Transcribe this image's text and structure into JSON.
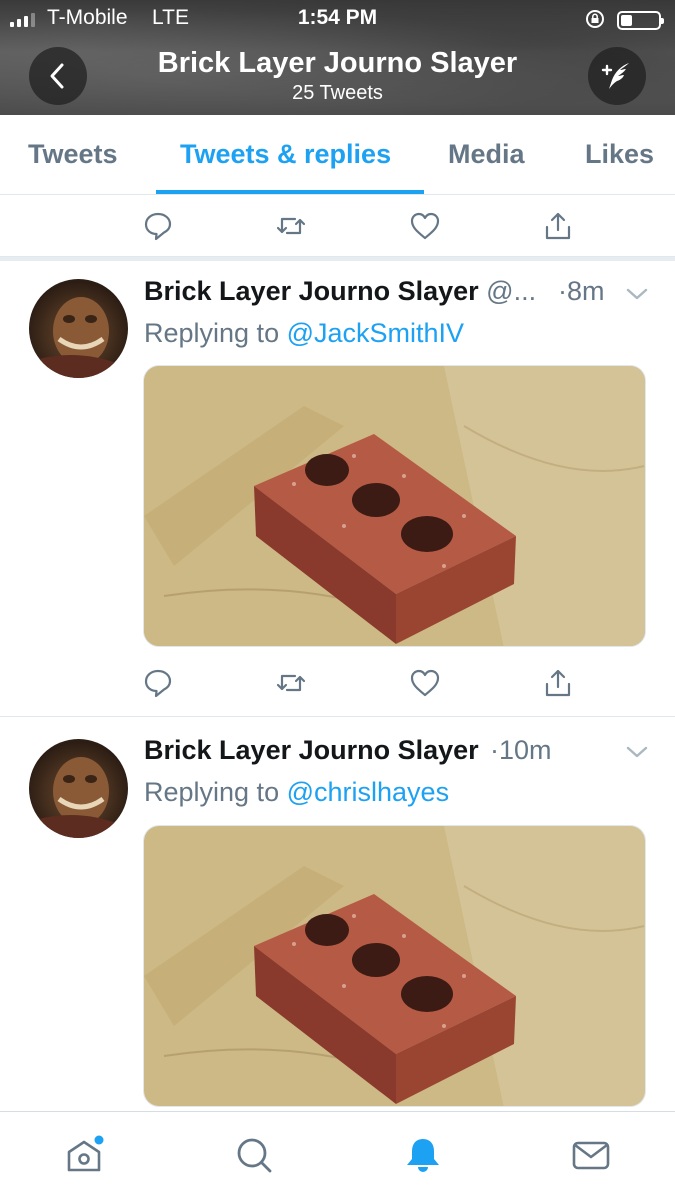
{
  "status_bar": {
    "carrier": "T-Mobile",
    "network": "LTE",
    "time": "1:54 PM",
    "signal_bars": 3,
    "battery_level": 0.3
  },
  "header": {
    "title": "Brick Layer Journo Slayer",
    "subtitle": "25 Tweets",
    "back_icon": "chevron-left-icon",
    "compose_icon": "compose-tweet-icon"
  },
  "tabs": [
    {
      "label": "Tweets",
      "active": false
    },
    {
      "label": "Tweets & replies",
      "active": true
    },
    {
      "label": "Media",
      "active": false
    },
    {
      "label": "Likes",
      "active": false
    }
  ],
  "tweets": [
    {
      "name": "Brick Layer Journo Slayer",
      "handle": "@...",
      "time": "·8m",
      "replying_prefix": "Replying to",
      "replying_to": "@JackSmithIV",
      "media_icon": "brick-image"
    },
    {
      "name": "Brick Layer Journo Slayer",
      "handle": "",
      "time": "·10m",
      "replying_prefix": "Replying to",
      "replying_to": "@chrislhayes",
      "media_icon": "brick-image"
    }
  ],
  "action_icons": [
    "reply-icon",
    "retweet-icon",
    "like-icon",
    "share-icon"
  ],
  "bottom_nav": [
    {
      "icon": "home-icon",
      "active": false,
      "has_dot": true
    },
    {
      "icon": "search-icon",
      "active": false
    },
    {
      "icon": "notifications-icon",
      "active": true
    },
    {
      "icon": "messages-icon",
      "active": false
    }
  ],
  "colors": {
    "accent": "#1da1f2",
    "secondary_text": "#657786",
    "icon_gray": "#657786"
  }
}
